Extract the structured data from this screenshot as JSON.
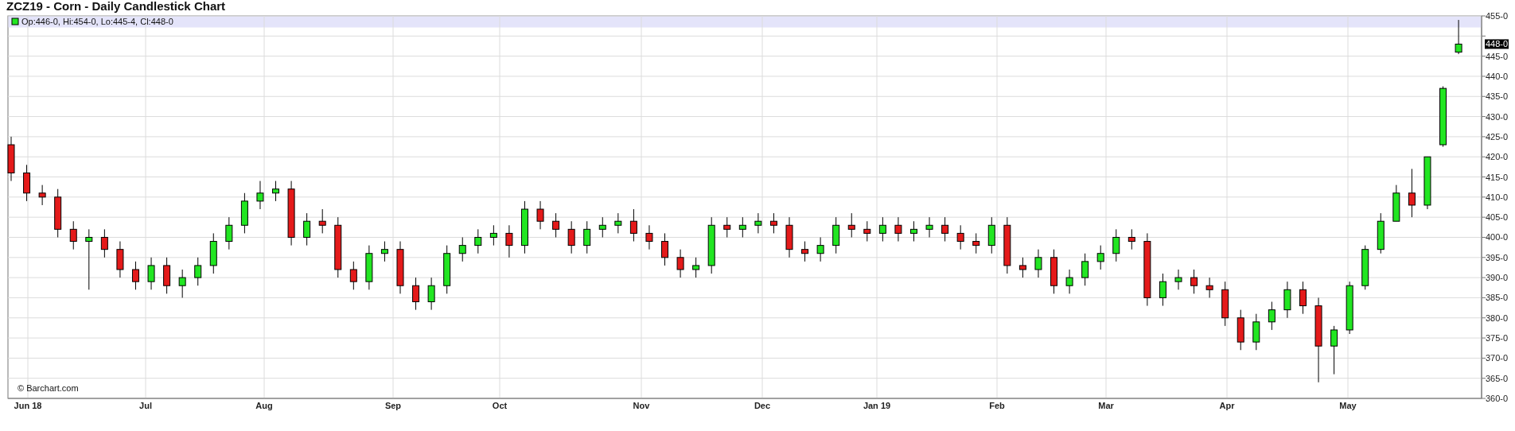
{
  "title": "ZCZ19 - Corn - Daily Candlestick Chart",
  "chart": {
    "legend": {
      "text": "Op:446-0, Hi:454-0, Lo:445-4, Cl:448-0",
      "color": "#22e622"
    },
    "credit": "© Barchart.com",
    "last_price_label": "448-0",
    "y_axis_labels": [
      "455-0",
      "445-0",
      "440-0",
      "435-0",
      "430-0",
      "425-0",
      "420-0",
      "415-0",
      "410-0",
      "405-0",
      "400-0",
      "395-0",
      "390-0",
      "385-0",
      "380-0",
      "375-0",
      "370-0",
      "365-0",
      "360-0"
    ],
    "x_axis_labels": [
      "Jun 18",
      "Jul",
      "Aug",
      "Sep",
      "Oct",
      "Nov",
      "Dec",
      "Jan 19",
      "Feb",
      "Mar",
      "Apr",
      "May"
    ]
  }
}
